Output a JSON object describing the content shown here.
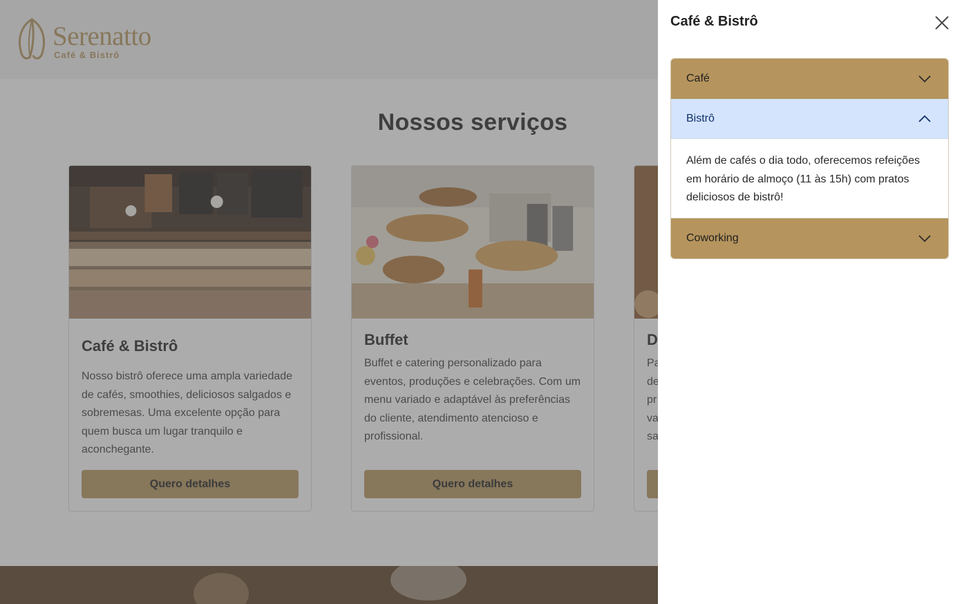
{
  "header": {
    "brand_name": "Serenatto",
    "brand_subtitle": "Café & Bistrô"
  },
  "main": {
    "section_title": "Nossos serviços",
    "cards": [
      {
        "title": "Café & Bistrô",
        "text": "Nosso bistrô oferece uma ampla variedade de cafés, smoothies, deliciosos salgados e sobremesas. Uma excelente opção para quem busca um lugar tranquilo e aconchegante.",
        "button_label": "Quero detalhes"
      },
      {
        "title": "Buffet",
        "text": "Buffet e catering personalizado para eventos, produções e celebrações. Com um menu variado e adaptável às preferências do cliente, atendimento atencioso e profissional.",
        "button_label": "Quero detalhes"
      },
      {
        "title": "De",
        "text_lines": [
          "Pa",
          "de",
          "pr",
          "va",
          "sa"
        ],
        "button_label": ""
      }
    ]
  },
  "offcanvas": {
    "title": "Café & Bistrô",
    "close_icon": "close-icon",
    "accordion": [
      {
        "label": "Café",
        "expanded": false,
        "icon": "chevron-down-icon"
      },
      {
        "label": "Bistrô",
        "expanded": true,
        "icon": "chevron-up-icon",
        "body": "Além de cafés o dia todo, oferecemos refeições em horário de almoço (11 às 15h) com pratos deliciosos de bistrô!"
      },
      {
        "label": "Coworking",
        "expanded": false,
        "icon": "chevron-down-icon"
      }
    ]
  },
  "colors": {
    "brand_gold": "#b5945d",
    "accordion_open_bg": "#d4e4fd",
    "overlay": "rgba(90,90,90,0.5)"
  }
}
